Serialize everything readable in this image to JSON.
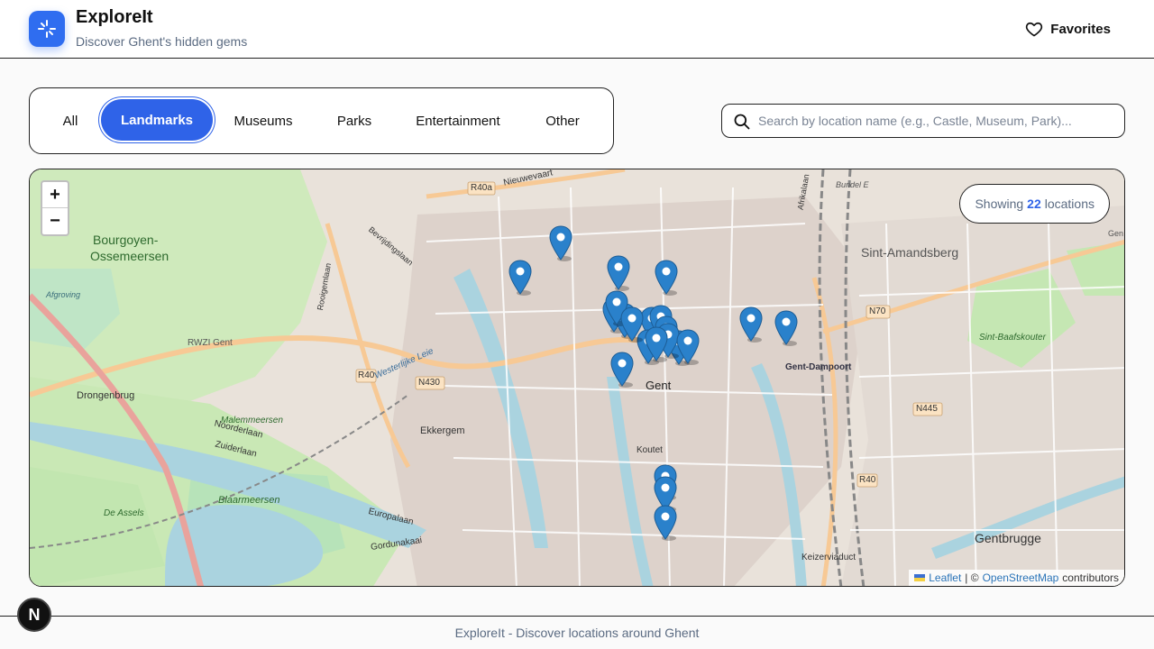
{
  "header": {
    "title": "ExploreIt",
    "subtitle": "Discover Ghent's hidden gems",
    "favorites_label": "Favorites"
  },
  "filters": {
    "items": [
      "All",
      "Landmarks",
      "Museums",
      "Parks",
      "Entertainment",
      "Other"
    ],
    "active": "Landmarks"
  },
  "search": {
    "placeholder": "Search by location name (e.g., Castle, Museum, Park)...",
    "value": ""
  },
  "map": {
    "zoom_in": "+",
    "zoom_out": "−",
    "count_prefix": "Showing",
    "count_value": "22",
    "count_suffix": "locations",
    "attribution": {
      "leaflet": "Leaflet",
      "sep": "| ©",
      "osm": "OpenStreetMap",
      "contributors": "contributors"
    },
    "labels": {
      "bourgoyen": "Bourgoyen-",
      "ossemeersen": "Ossemeersen",
      "drongenbrug": "Drongenbrug",
      "ekkergem": "Ekkergem",
      "gent": "Gent",
      "sint_amandsberg": "Sint-Amandsberg",
      "gentbrugge": "Gentbrugge",
      "blaarmeersen": "Blaarmeersen",
      "malemmeersen": "Malemmeersen",
      "rwzi": "RWZI Gent",
      "keizerviaduct": "Keizerviaduct",
      "koutet": "Koutet",
      "gent_dampoort": "Gent-Dampoort",
      "sint_baafskouter": "Sint-Baafskouter",
      "r40a": "R40a",
      "r40": "R40",
      "r40_2": "R40",
      "n430": "N430",
      "n70": "N70",
      "n445": "N445",
      "nieuwevaart": "Nieuwevaart",
      "noorderlaan": "Noorderlaan",
      "zuiderlaan": "Zuiderlaan",
      "europalaan": "Europalaan",
      "gordunakaai": "Gordunakaai",
      "de_assels": "De Assels",
      "afgroving": "Afgroving",
      "bevrijdingslaan": "Bevrijdingslaan",
      "rooigemlaan": "Rooigemlaan",
      "westerlijke_leie": "Westerlijke Leie",
      "afrikalaan": "Afrikalaan",
      "bundel_e": "Bundel E",
      "gen": "Gen"
    }
  },
  "footer": {
    "text": "ExploreIt - Discover locations around Ghent",
    "badge": "N"
  },
  "colors": {
    "accent": "#2f63e8",
    "marker": "#2a81cb",
    "water": "#aad3df",
    "park": "#c8facc"
  }
}
